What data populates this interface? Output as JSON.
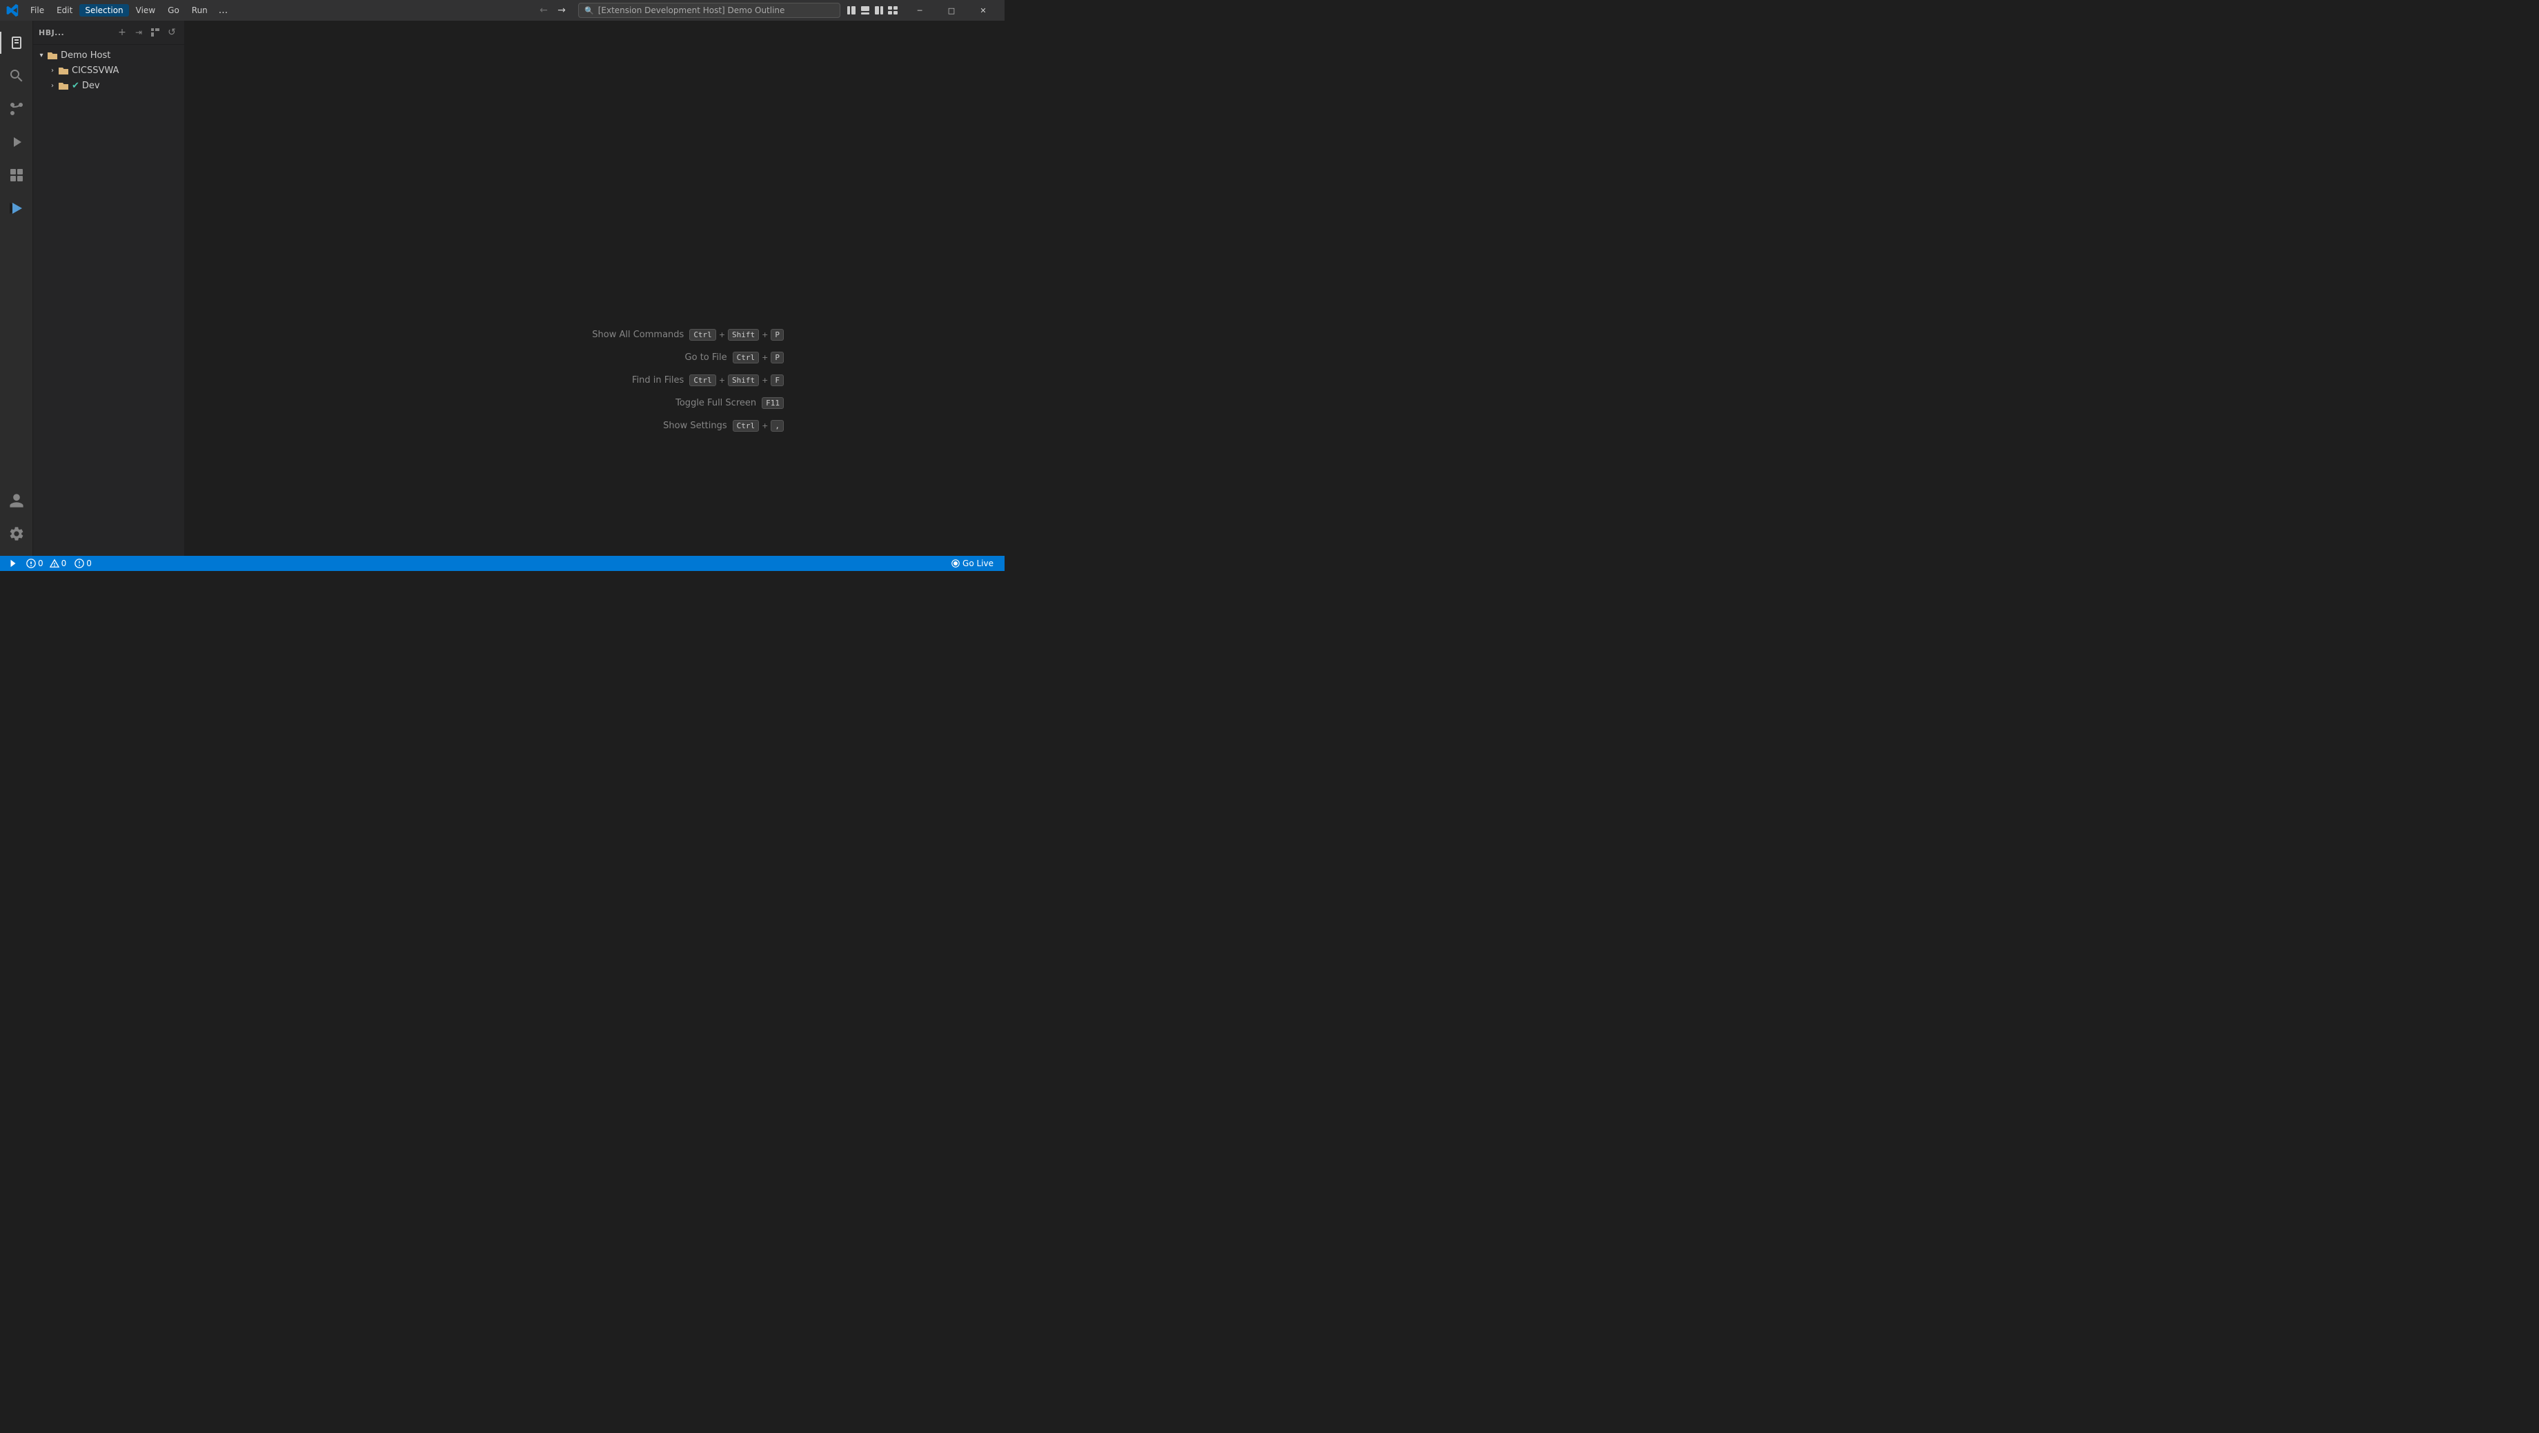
{
  "titlebar": {
    "menu_items": [
      "File",
      "Edit",
      "Selection",
      "View",
      "Go",
      "Run"
    ],
    "more_label": "...",
    "search_text": "[Extension Development Host] Demo Outline",
    "nav_back": "←",
    "nav_forward": "→",
    "window_controls": [
      "─",
      "□",
      "✕"
    ]
  },
  "sidebar": {
    "title": "HBJ...",
    "actions": {
      "new_file": "+",
      "new_folder": "→",
      "refresh": "⟳",
      "collapse": "⊡"
    },
    "tree": {
      "root": {
        "label": "Demo Host",
        "expanded": true,
        "children": [
          {
            "label": "CICSSVWA",
            "expanded": false,
            "type": "folder"
          },
          {
            "label": "Dev",
            "expanded": false,
            "type": "folder-checked"
          }
        ]
      }
    }
  },
  "activity_bar": {
    "items": [
      {
        "name": "explorer",
        "icon": "⎘",
        "active": true
      },
      {
        "name": "search",
        "icon": "🔍"
      },
      {
        "name": "source-control",
        "icon": "⑂"
      },
      {
        "name": "run-debug",
        "icon": "▷"
      },
      {
        "name": "extensions",
        "icon": "⊞"
      },
      {
        "name": "remote-explorer",
        "icon": "<>"
      }
    ],
    "bottom_items": [
      {
        "name": "account",
        "icon": "👤"
      },
      {
        "name": "settings",
        "icon": "⚙"
      }
    ]
  },
  "shortcuts": [
    {
      "label": "Show All Commands",
      "keys": [
        "Ctrl",
        "+",
        "Shift",
        "+",
        "P"
      ]
    },
    {
      "label": "Go to File",
      "keys": [
        "Ctrl",
        "+",
        "P"
      ]
    },
    {
      "label": "Find in Files",
      "keys": [
        "Ctrl",
        "+",
        "Shift",
        "+",
        "F"
      ]
    },
    {
      "label": "Toggle Full Screen",
      "keys": [
        "F11"
      ]
    },
    {
      "label": "Show Settings",
      "keys": [
        "Ctrl",
        "+",
        ","
      ]
    }
  ],
  "statusbar": {
    "left": [
      {
        "icon": "✕",
        "text": ""
      },
      {
        "icon": "⚠",
        "text": "0"
      },
      {
        "icon": "⚠",
        "text": "0"
      },
      {
        "icon": "✓",
        "text": "0"
      }
    ],
    "right": {
      "go_live_label": "Go Live"
    }
  }
}
